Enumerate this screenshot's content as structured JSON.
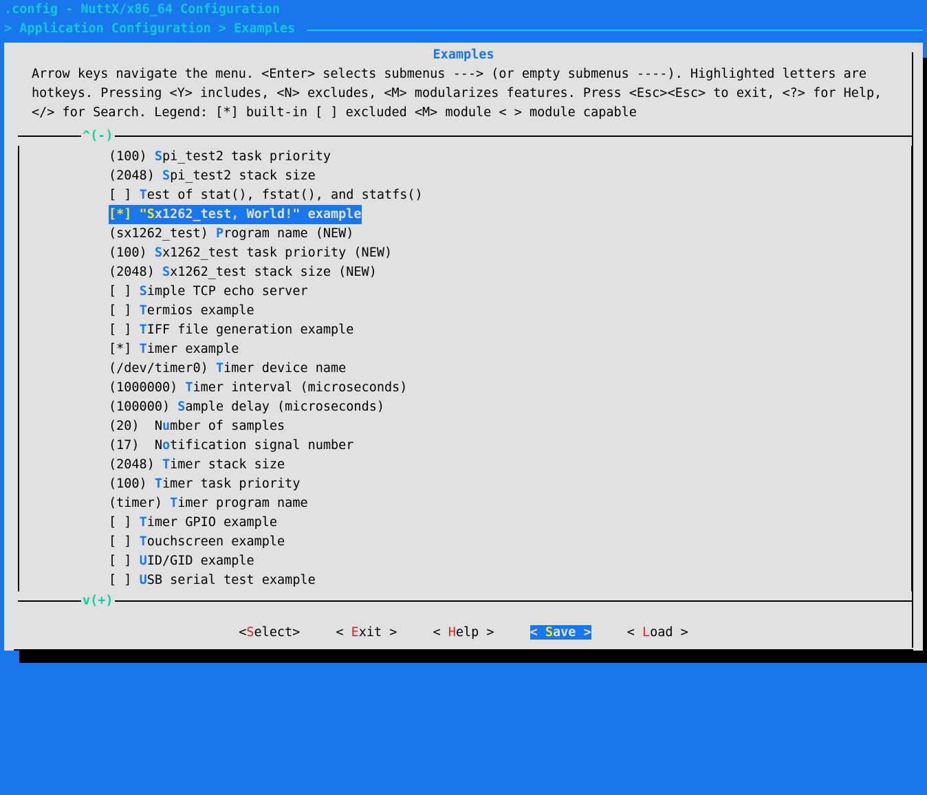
{
  "header": {
    "title": ".config - NuttX/x86_64 Configuration",
    "breadcrumb": "> Application Configuration > Examples "
  },
  "panel": {
    "title": "Examples",
    "help": "Arrow keys navigate the menu.  <Enter> selects submenus ---> (or empty submenus ----). Highlighted letters are hotkeys.  Pressing <Y> includes, <N> excludes, <M> modularizes features.  Press <Esc><Esc> to exit, <?> for Help, </> for Search.  Legend: [*] built-in  [ ] excluded  <M> module  < > module capable"
  },
  "scroll": {
    "up": "^(-)",
    "down": "v(+)"
  },
  "items": [
    {
      "prefix": "(100) ",
      "hot": "S",
      "rest": "pi_test2 task priority",
      "sel": false
    },
    {
      "prefix": "(2048) ",
      "hot": "S",
      "rest": "pi_test2 stack size",
      "sel": false
    },
    {
      "prefix": "[ ] ",
      "hot": "T",
      "rest": "est of stat(), fstat(), and statfs()",
      "sel": false
    },
    {
      "prefix": "[*] ",
      "hot": "\"S",
      "rest": "x1262_test, World!\" example",
      "sel": true
    },
    {
      "prefix": "(sx1262_test) ",
      "hot": "P",
      "rest": "rogram name (NEW)",
      "sel": false
    },
    {
      "prefix": "(100) ",
      "hot": "S",
      "rest": "x1262_test task priority (NEW)",
      "sel": false
    },
    {
      "prefix": "(2048) ",
      "hot": "S",
      "rest": "x1262_test stack size (NEW)",
      "sel": false
    },
    {
      "prefix": "[ ] ",
      "hot": "S",
      "rest": "imple TCP echo server",
      "sel": false
    },
    {
      "prefix": "[ ] ",
      "hot": "T",
      "rest": "ermios example",
      "sel": false
    },
    {
      "prefix": "[ ] ",
      "hot": "T",
      "rest": "IFF file generation example",
      "sel": false
    },
    {
      "prefix": "[*] ",
      "hot": "T",
      "rest": "imer example",
      "sel": false
    },
    {
      "prefix": "(/dev/timer0) ",
      "hot": "T",
      "rest": "imer device name",
      "sel": false
    },
    {
      "prefix": "(1000000) ",
      "hot": "T",
      "rest": "imer interval (microseconds)",
      "sel": false
    },
    {
      "prefix": "(100000) ",
      "hot": "S",
      "rest": "ample delay (microseconds)",
      "sel": false
    },
    {
      "prefix": "(20)  N",
      "hot": "u",
      "rest": "mber of samples",
      "sel": false
    },
    {
      "prefix": "(17)  N",
      "hot": "o",
      "rest": "tification signal number",
      "sel": false
    },
    {
      "prefix": "(2048) ",
      "hot": "T",
      "rest": "imer stack size",
      "sel": false
    },
    {
      "prefix": "(100) ",
      "hot": "T",
      "rest": "imer task priority",
      "sel": false
    },
    {
      "prefix": "(timer) ",
      "hot": "T",
      "rest": "imer program name",
      "sel": false
    },
    {
      "prefix": "[ ] ",
      "hot": "T",
      "rest": "imer GPIO example",
      "sel": false
    },
    {
      "prefix": "[ ] ",
      "hot": "T",
      "rest": "ouchscreen example",
      "sel": false
    },
    {
      "prefix": "[ ] ",
      "hot": "U",
      "rest": "ID/GID example",
      "sel": false
    },
    {
      "prefix": "[ ] ",
      "hot": "U",
      "rest": "SB serial test example",
      "sel": false
    }
  ],
  "buttons": {
    "select": {
      "hot": "S",
      "rest": "elect"
    },
    "exit": {
      "hot": "E",
      "rest": "xit"
    },
    "help": {
      "hot": "H",
      "rest": "elp"
    },
    "save": {
      "hot": "S",
      "rest": "ave"
    },
    "load": {
      "hot": "L",
      "rest": "oad"
    }
  }
}
